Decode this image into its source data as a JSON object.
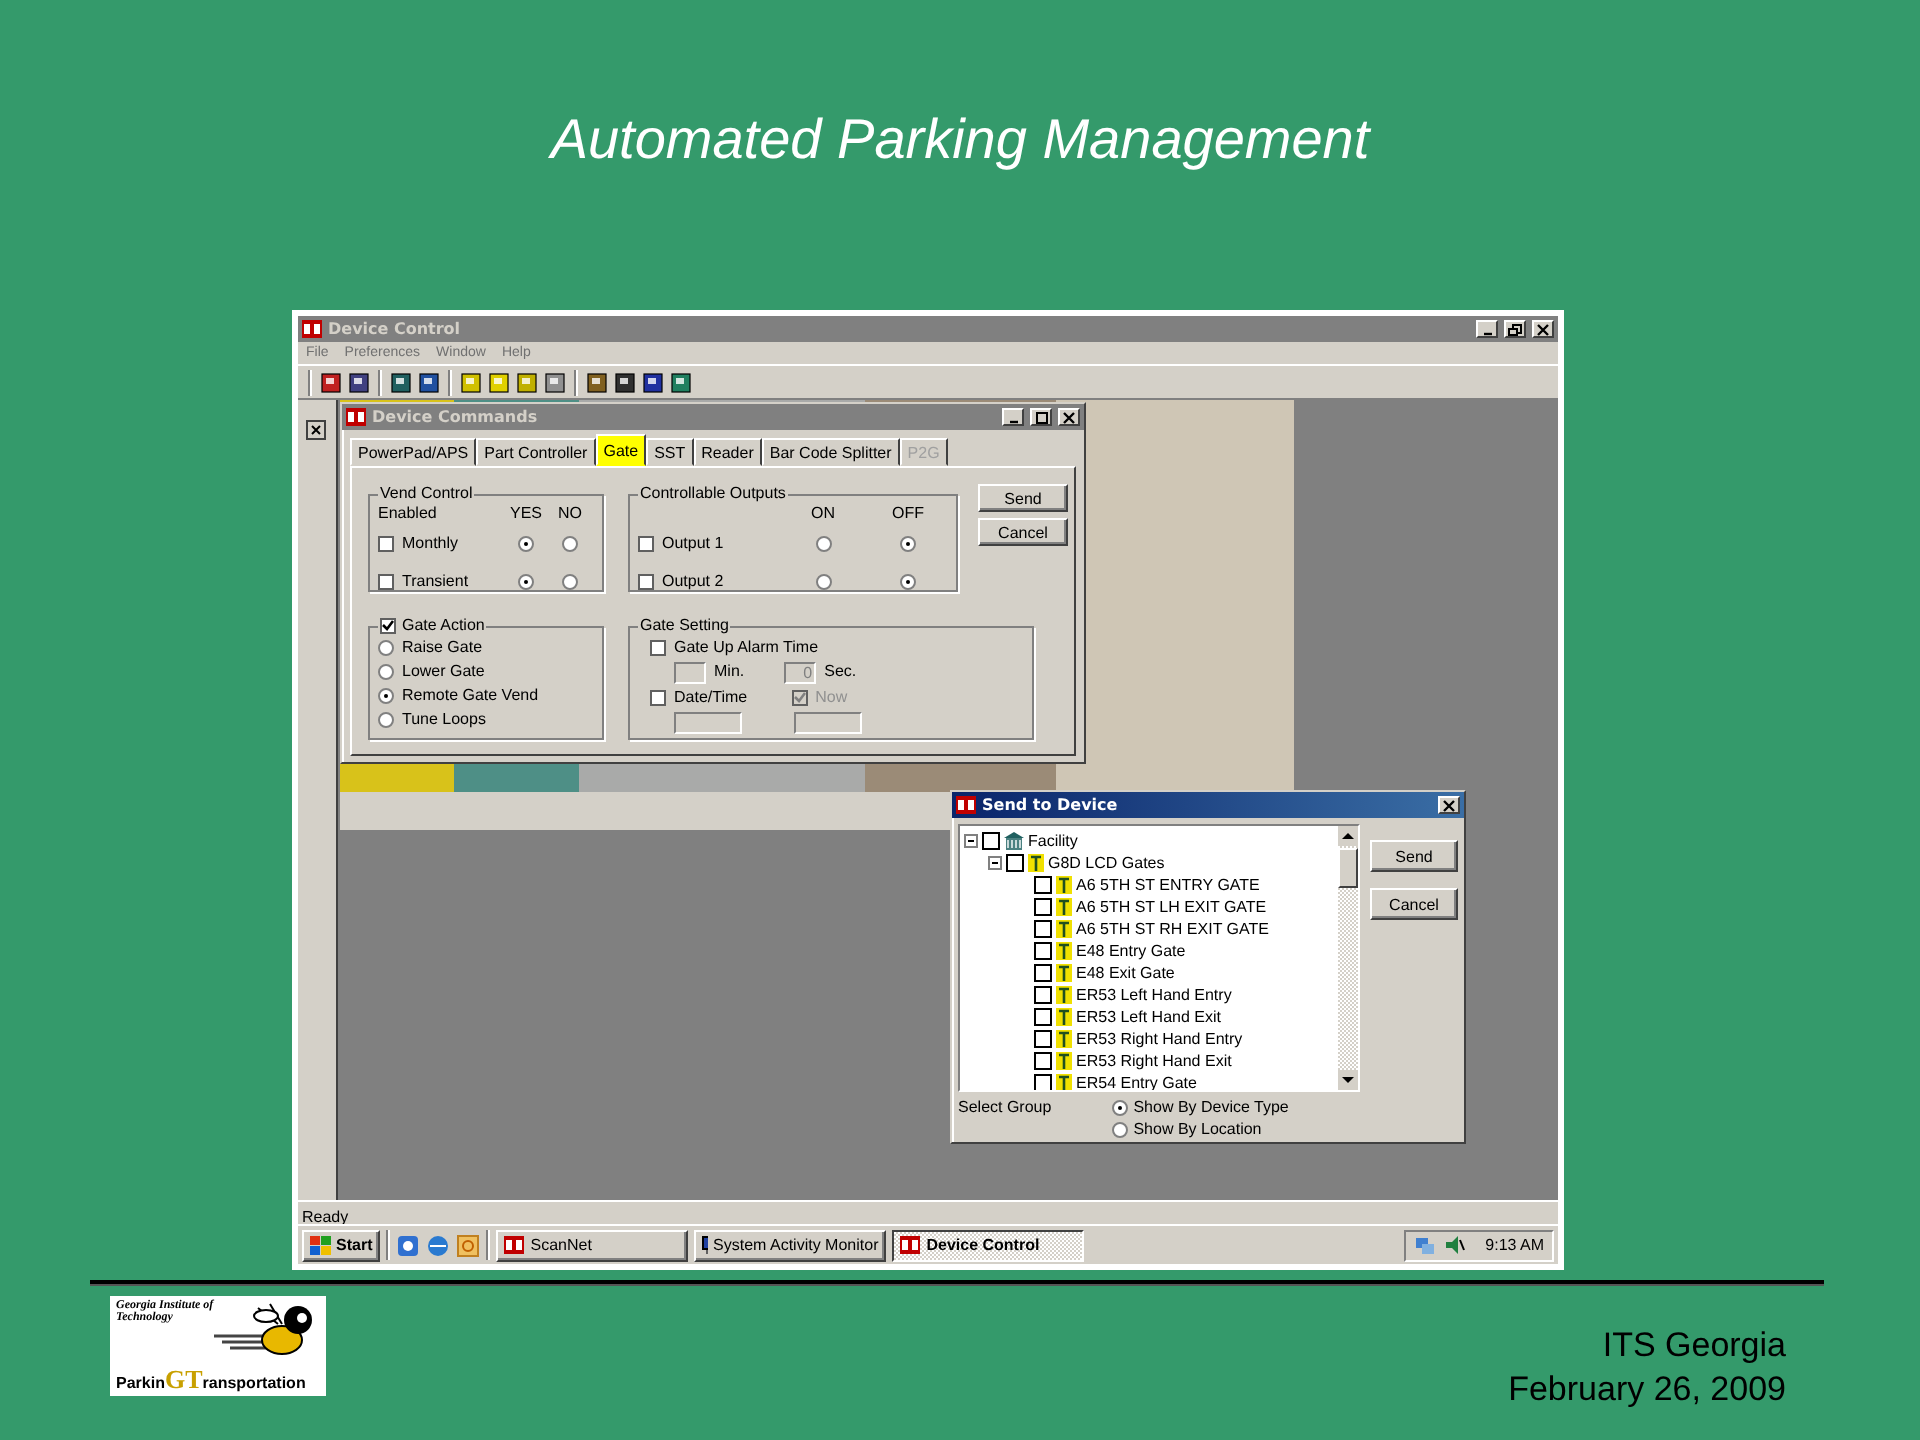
{
  "slide_title": "Automated Parking Management",
  "app": {
    "title": "Device Control",
    "menu": [
      "File",
      "Preferences",
      "Window",
      "Help"
    ],
    "status": "Ready"
  },
  "device_commands": {
    "title": "Device Commands",
    "tabs": [
      {
        "label": "PowerPad/APS",
        "selected": false,
        "disabled": false
      },
      {
        "label": "Part Controller",
        "selected": false,
        "disabled": false
      },
      {
        "label": "Gate",
        "selected": true,
        "disabled": false
      },
      {
        "label": "SST",
        "selected": false,
        "disabled": false
      },
      {
        "label": "Reader",
        "selected": false,
        "disabled": false
      },
      {
        "label": "Bar Code Splitter",
        "selected": false,
        "disabled": false
      },
      {
        "label": "P2G",
        "selected": false,
        "disabled": true
      }
    ],
    "vend_control": {
      "title": "Vend Control",
      "headers": [
        "Enabled",
        "YES",
        "NO"
      ],
      "rows": [
        {
          "label": "Monthly",
          "enabled": false,
          "yes": true
        },
        {
          "label": "Transient",
          "enabled": false,
          "yes": true
        }
      ]
    },
    "outputs": {
      "title": "Controllable Outputs",
      "headers": [
        "ON",
        "OFF"
      ],
      "rows": [
        {
          "label": "Output 1",
          "enabled": false,
          "on": false
        },
        {
          "label": "Output 2",
          "enabled": false,
          "on": false
        }
      ]
    },
    "gate_action": {
      "label": "Gate Action",
      "checked": true,
      "options": [
        {
          "label": "Raise Gate",
          "selected": false
        },
        {
          "label": "Lower Gate",
          "selected": false
        },
        {
          "label": "Remote Gate Vend",
          "selected": true
        },
        {
          "label": "Tune Loops",
          "selected": false
        }
      ]
    },
    "gate_setting": {
      "title": "Gate Setting",
      "alarm": {
        "label": "Gate Up Alarm Time",
        "checked": false
      },
      "alarm_fields": [
        {
          "unit": "Min.",
          "disabled": true
        },
        {
          "value": "0",
          "unit": "Sec.",
          "disabled": true
        }
      ],
      "date_time": {
        "label": "Date/Time",
        "checked": false
      },
      "now": {
        "label": "Now",
        "checked": true,
        "disabled": true
      },
      "date_fields": [
        {
          "disabled": true
        },
        {
          "disabled": true
        }
      ]
    },
    "buttons": [
      "Send",
      "Cancel"
    ]
  },
  "send_to_device": {
    "title": "Send to Device",
    "tree": [
      {
        "kind": "facility",
        "label": "Facility",
        "checked": false,
        "expanded": true,
        "children": [
          {
            "kind": "group",
            "label": "G8D LCD Gates",
            "checked": false,
            "expanded": true,
            "children": [
              {
                "kind": "gate",
                "label": "A6 5TH ST ENTRY GATE",
                "checked": false
              },
              {
                "kind": "gate",
                "label": "A6 5TH ST LH EXIT GATE",
                "checked": false
              },
              {
                "kind": "gate",
                "label": "A6 5TH ST RH EXIT GATE",
                "checked": false
              },
              {
                "kind": "gate",
                "label": "E48 Entry Gate",
                "checked": false
              },
              {
                "kind": "gate",
                "label": "E48 Exit Gate",
                "checked": false
              },
              {
                "kind": "gate",
                "label": "ER53 Left Hand Entry",
                "checked": false
              },
              {
                "kind": "gate",
                "label": "ER53 Left Hand Exit",
                "checked": false
              },
              {
                "kind": "gate",
                "label": "ER53 Right Hand Entry",
                "checked": false
              },
              {
                "kind": "gate",
                "label": "ER53 Right Hand Exit",
                "checked": false
              },
              {
                "kind": "gate",
                "label": "ER54 Entry Gate",
                "checked": false
              }
            ]
          }
        ]
      }
    ],
    "buttons": [
      "Send",
      "Cancel"
    ],
    "select_group": {
      "label": "Select Group",
      "options": [
        {
          "label": "Show By Device Type",
          "selected": true
        },
        {
          "label": "Show By Location",
          "selected": false
        }
      ]
    }
  },
  "taskbar": {
    "start": "Start",
    "tasks": [
      {
        "label": "ScanNet",
        "selected": false
      },
      {
        "label": "System Activity Monitor",
        "selected": false
      },
      {
        "label": "Device Control",
        "selected": true
      }
    ],
    "clock": "9:13 AM"
  },
  "footer": {
    "logo": {
      "caption": "Georgia Institute of Technology",
      "word_start": "Parkin",
      "monogram": "GT",
      "word_end": "ransportation"
    },
    "org": "ITS Georgia",
    "date": "February 26, 2009"
  }
}
